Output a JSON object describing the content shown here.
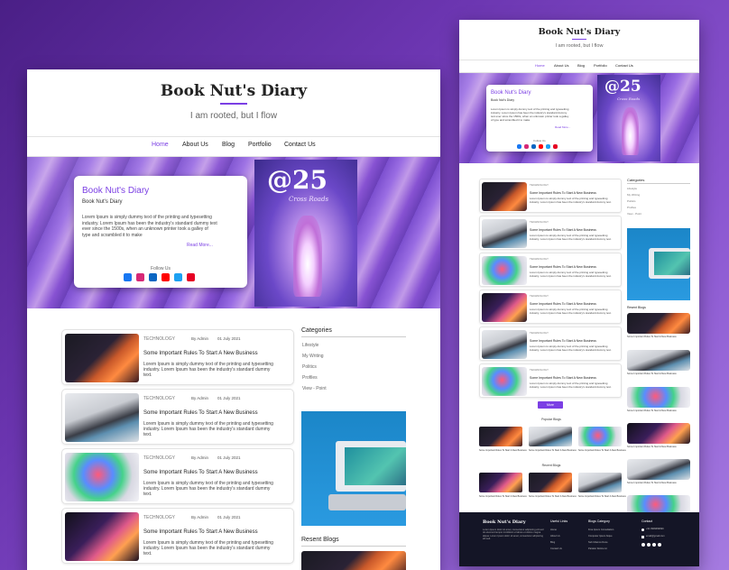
{
  "colors": {
    "accent": "#7b3fe4",
    "brand": "#7b3fe4",
    "footer": "#141526"
  },
  "site": {
    "title": "Book Nut's Diary",
    "tagline": "I am rooted, but I flow"
  },
  "nav": [
    "Home",
    "About Us",
    "Blog",
    "Portfolio",
    "Contact Us"
  ],
  "hero": {
    "card_title": "Book Nut's Diary",
    "card_subtitle": "Book Nut's Diary",
    "card_text": "Lorem Ipsum is simply dummy text of the printing and typesetting industry. Lorem Ipsum has been the industry's standard dummy text ever since the 1500s, when an unknown printer took a galley of type and scrambled it to make",
    "read_more": "Read More...",
    "follow": "Follow Us",
    "social_icons": [
      "facebook-icon",
      "instagram-icon",
      "linkedin-icon",
      "youtube-icon",
      "twitter-icon",
      "pinterest-icon"
    ],
    "cover_number": "@25",
    "cover_caption": "Cross Roads"
  },
  "posts": {
    "category": "TECHNOLOGY",
    "author": "By Admin",
    "date": "01 July 2021",
    "title": "Some Important Rules To Start A New Business",
    "excerpt": "Lorem Ipsum is simply dummy text of the printing and typesetting industry. Lorem Ipsum has been the industry's standard dummy text."
  },
  "sidebar": {
    "categories_heading": "Categories",
    "categories": [
      "Lifestyle",
      "My Writing",
      "Politics",
      "Profiles",
      "View - Point"
    ],
    "recent_heading": "Resent Blogs",
    "recent_title": "Some Important Rules To Start A New Business"
  },
  "more_button": "More",
  "popular_heading": "Popular Blogs",
  "recent_heading": "Recent Blogs",
  "grid_title": "Some Important Rules To Start A New Business",
  "footer": {
    "brand": "Book Nut's Diary",
    "about": "Lorem Ipsum dolor sit amet, consectetur adipiscing elit sed do eiusmod tempor incididunt ut labore et dolore magna aliqua. Lorem Ipsum dolor sit amet, consectetur adipiscing elit sed.",
    "useful_heading": "Useful Links",
    "useful_links": [
      "Home",
      "About Us",
      "Blog",
      "Contact Us"
    ],
    "category_heading": "Blogs Category",
    "category_links": [
      "Free Ipsum Consultation",
      "Computer Ipsum Atque",
      "Sub Ullamco Dune",
      "Pariatur Dolore Lit"
    ],
    "contact_heading": "Contact",
    "phone": "+91 9999999999",
    "email": "email@gmail.com"
  }
}
